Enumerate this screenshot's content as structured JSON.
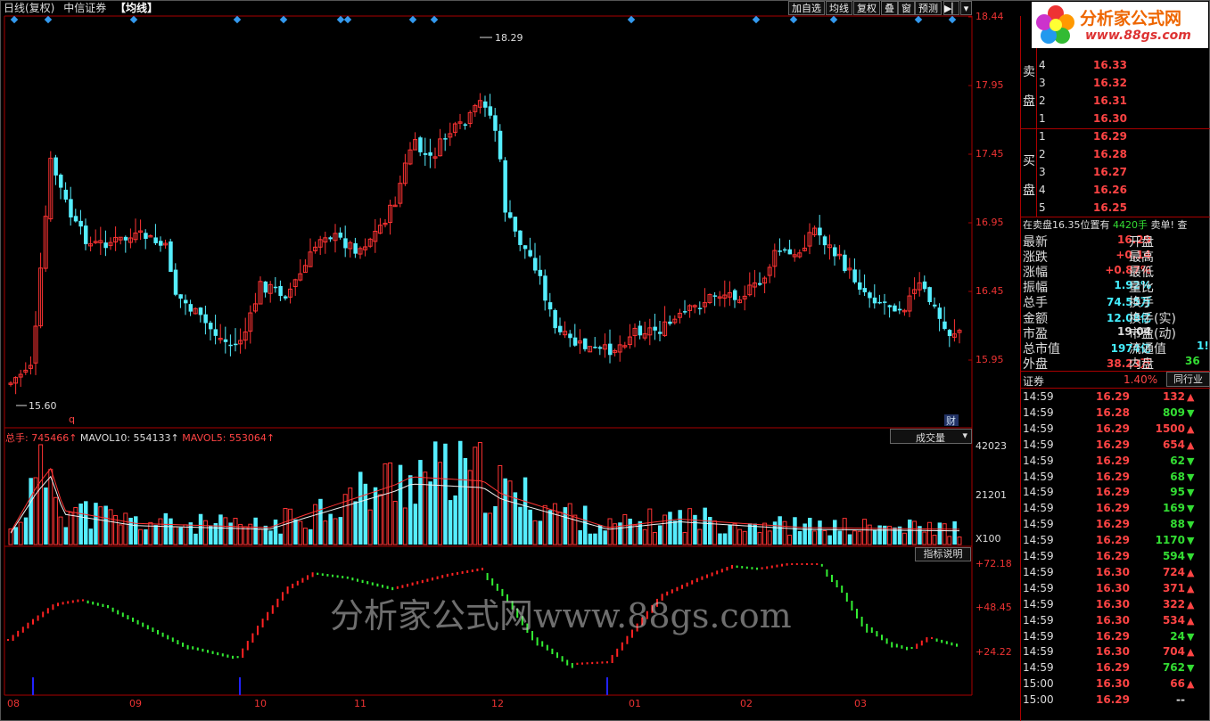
{
  "topbar": {
    "period": "日线(复权)",
    "stock": "中信证券",
    "indicator": "【均线】"
  },
  "toolbar": {
    "add": "加自选",
    "ma": "均线",
    "adj": "复权",
    "overlay": "叠",
    "window": "窗",
    "forecast": "预测"
  },
  "price_axis": [
    "18.44",
    "17.95",
    "17.45",
    "16.95",
    "16.45",
    "15.95"
  ],
  "price_marks": {
    "high": "18.29",
    "low": "15.60"
  },
  "markers": {
    "q": "q",
    "cai": "财"
  },
  "volume": {
    "legend_total": "总手: 745466↑",
    "legend_ma10": "MAVOL10: 554133↑",
    "legend_ma5": "MAVOL5: 553064↑",
    "dropdown": "成交量",
    "axis": [
      "42023",
      "21201"
    ],
    "unit": "X100"
  },
  "indicator": {
    "button": "指标说明",
    "axis": [
      "+72.18",
      "+48.45",
      "+24.22"
    ]
  },
  "months": [
    "08",
    "09",
    "10",
    "11",
    "12",
    "01",
    "02",
    "03"
  ],
  "watermark": "分析家公式网www.88gs.com",
  "logo": {
    "title": "分析家公式网",
    "url": "www.88gs.com"
  },
  "orderbook": {
    "sell_label_1": "卖",
    "sell_label_2": "盘",
    "buy_label_1": "买",
    "buy_label_2": "盘",
    "sell": [
      {
        "n": "4",
        "p": "16.33"
      },
      {
        "n": "3",
        "p": "16.32"
      },
      {
        "n": "2",
        "p": "16.31"
      },
      {
        "n": "1",
        "p": "16.30"
      }
    ],
    "buy": [
      {
        "n": "1",
        "p": "16.29"
      },
      {
        "n": "2",
        "p": "16.28"
      },
      {
        "n": "3",
        "p": "16.27"
      },
      {
        "n": "4",
        "p": "16.26"
      },
      {
        "n": "5",
        "p": "16.25"
      }
    ],
    "note": "在卖盘16.35位置有",
    "note_qty": "4420手",
    "note_tag": "卖单! 查"
  },
  "quote": [
    {
      "label": "最新",
      "value": "16.29",
      "label2": "开盘",
      "color": "#f44"
    },
    {
      "label": "涨跌",
      "value": "+0.14",
      "label2": "最高",
      "color": "#f44"
    },
    {
      "label": "涨幅",
      "value": "+0.87%",
      "label2": "最低",
      "color": "#f44"
    },
    {
      "label": "振幅",
      "value": "1.92%",
      "label2": "量比",
      "color": "#4ef"
    },
    {
      "label": "总手",
      "value": "74.55万",
      "label2": "换手",
      "color": "#4ef"
    },
    {
      "label": "金额",
      "value": "12.08亿",
      "label2": "换手(实)",
      "color": "#4ef"
    },
    {
      "label": "市盈",
      "value": "19.04",
      "label2": "市盈(动)",
      "color": "#ddd"
    },
    {
      "label": "总市值",
      "value": "1974亿",
      "label2": "流通值",
      "color": "#4ef"
    },
    {
      "label": "外盘",
      "value": "38.23万",
      "label2": "内盘",
      "color": "#f44"
    }
  ],
  "quote_extra": {
    "liutong": "1!",
    "neipan": "36"
  },
  "sector": {
    "name": "证券",
    "pct": "1.40%",
    "btn": "同行业"
  },
  "trades": [
    {
      "t": "14:59",
      "p": "16.29",
      "v": "132",
      "d": "up"
    },
    {
      "t": "14:59",
      "p": "16.28",
      "v": "809",
      "d": "down"
    },
    {
      "t": "14:59",
      "p": "16.29",
      "v": "1500",
      "d": "up"
    },
    {
      "t": "14:59",
      "p": "16.29",
      "v": "654",
      "d": "up"
    },
    {
      "t": "14:59",
      "p": "16.29",
      "v": "62",
      "d": "down"
    },
    {
      "t": "14:59",
      "p": "16.29",
      "v": "68",
      "d": "down"
    },
    {
      "t": "14:59",
      "p": "16.29",
      "v": "95",
      "d": "down"
    },
    {
      "t": "14:59",
      "p": "16.29",
      "v": "169",
      "d": "down"
    },
    {
      "t": "14:59",
      "p": "16.29",
      "v": "88",
      "d": "down"
    },
    {
      "t": "14:59",
      "p": "16.29",
      "v": "1170",
      "d": "down"
    },
    {
      "t": "14:59",
      "p": "16.29",
      "v": "594",
      "d": "down"
    },
    {
      "t": "14:59",
      "p": "16.30",
      "v": "724",
      "d": "up"
    },
    {
      "t": "14:59",
      "p": "16.30",
      "v": "371",
      "d": "up"
    },
    {
      "t": "14:59",
      "p": "16.30",
      "v": "322",
      "d": "up"
    },
    {
      "t": "14:59",
      "p": "16.30",
      "v": "534",
      "d": "up"
    },
    {
      "t": "14:59",
      "p": "16.29",
      "v": "24",
      "d": "down"
    },
    {
      "t": "14:59",
      "p": "16.30",
      "v": "704",
      "d": "up"
    },
    {
      "t": "14:59",
      "p": "16.29",
      "v": "762",
      "d": "down"
    },
    {
      "t": "15:00",
      "p": "16.30",
      "v": "66",
      "d": "up"
    },
    {
      "t": "15:00",
      "p": "16.29",
      "v": "--",
      "d": "none"
    }
  ]
}
